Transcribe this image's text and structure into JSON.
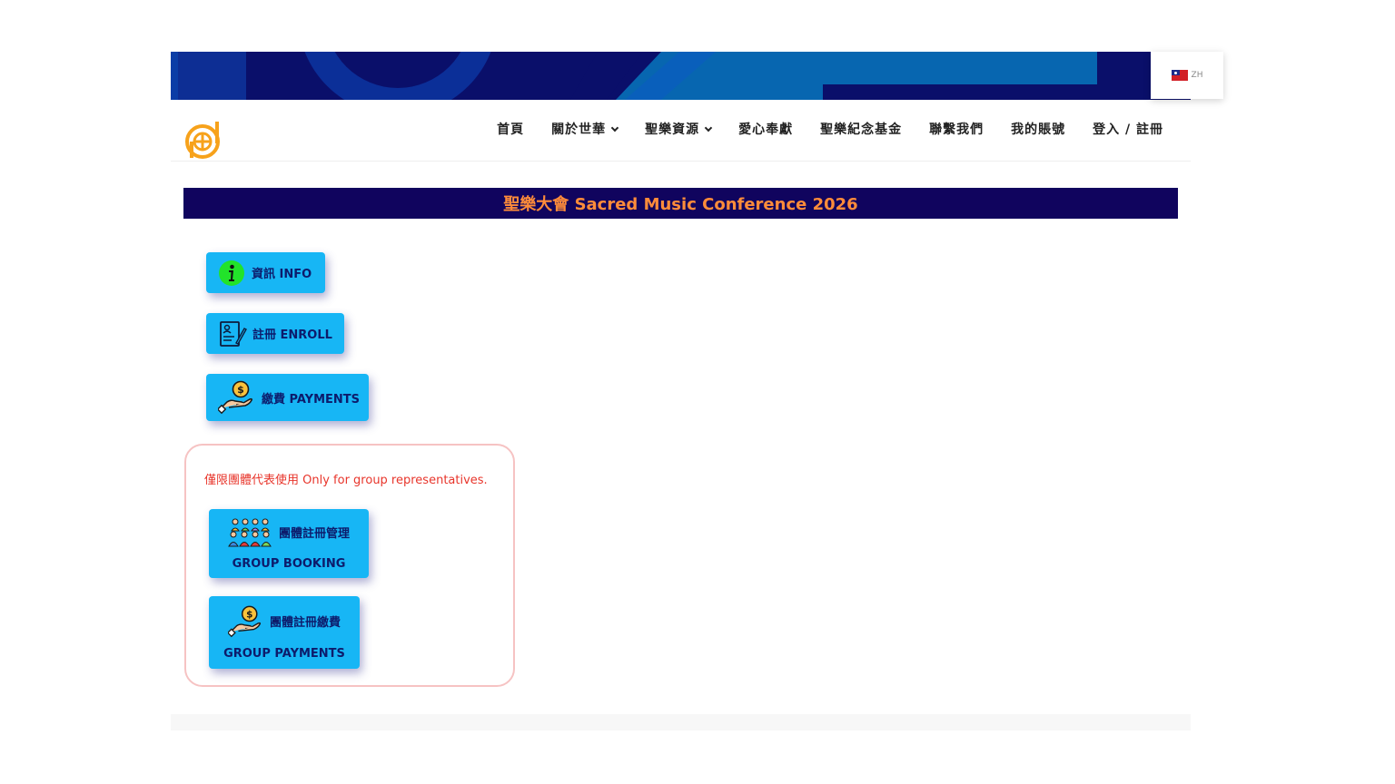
{
  "language": {
    "code": "ZH"
  },
  "nav": {
    "items": [
      {
        "label": "首頁",
        "dropdown": false
      },
      {
        "label": "關於世華",
        "dropdown": true
      },
      {
        "label": "聖樂資源",
        "dropdown": true
      },
      {
        "label": "愛心奉獻",
        "dropdown": false
      },
      {
        "label": "聖樂紀念基金",
        "dropdown": false
      },
      {
        "label": "聯繫我們",
        "dropdown": false
      },
      {
        "label": "我的賬號",
        "dropdown": false
      },
      {
        "label": "登入 / 註冊",
        "dropdown": false
      }
    ]
  },
  "title": "聖樂大會 Sacred Music Conference 2026",
  "buttons": {
    "info": {
      "label": "資訊 INFO",
      "icon": "info-icon"
    },
    "enroll": {
      "label": "註冊 ENROLL",
      "icon": "enroll-form-icon"
    },
    "payments": {
      "label": "繳費 PAYMENTS",
      "icon": "coin-hand-icon"
    }
  },
  "group": {
    "note": "僅限團體代表使用 Only for group representatives.",
    "booking": {
      "label_zh": "團體註冊管理",
      "label_en": "GROUP BOOKING",
      "icon": "group-people-icon"
    },
    "payments": {
      "label_zh": "團體註冊繳費",
      "label_en": "GROUP PAYMENTS",
      "icon": "coin-hand-icon"
    }
  },
  "colors": {
    "button_bg": "#17b6f5",
    "button_text": "#0d1b6b",
    "title_bar_bg": "#10045e",
    "title_text": "#ff8c3a",
    "note_text": "#e8352b",
    "brand_orange": "#f7a21b"
  }
}
